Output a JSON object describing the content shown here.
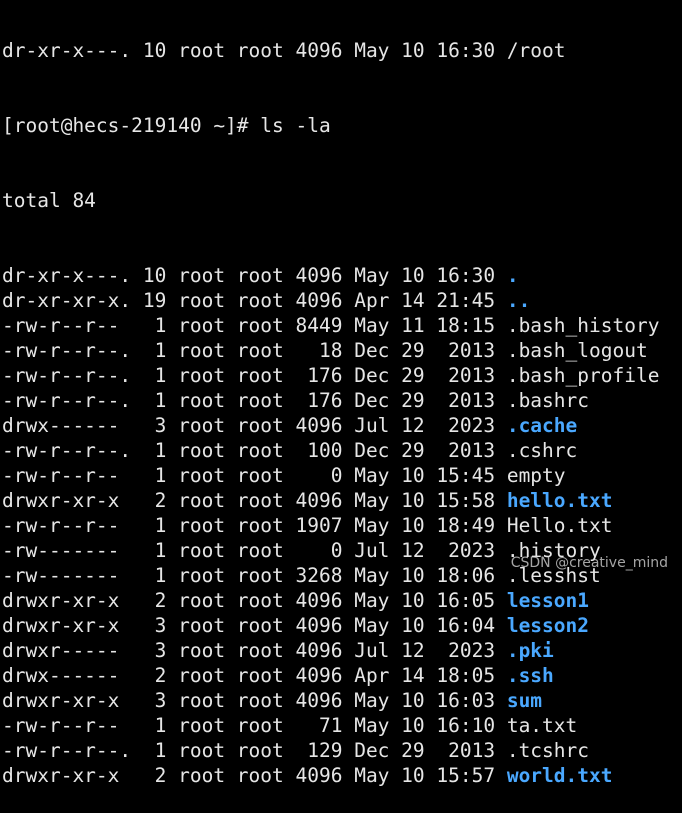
{
  "colors": {
    "background": "#000000",
    "text": "#e6e6e6",
    "directory": "#4aa8ff"
  },
  "terminal": {
    "partial_top_line": "dr-xr-x---. 10 root root 4096 May 10 16:30 /root",
    "prompt_line": "[root@hecs-219140 ~]# ls -la",
    "total_line": "total 84",
    "entries": [
      {
        "meta": "dr-xr-x---. 10 root root 4096 May 10 16:30 ",
        "name": ".",
        "dir": true
      },
      {
        "meta": "dr-xr-xr-x. 19 root root 4096 Apr 14 21:45 ",
        "name": "..",
        "dir": true
      },
      {
        "meta": "-rw-r--r--   1 root root 8449 May 11 18:15 ",
        "name": ".bash_history",
        "dir": false
      },
      {
        "meta": "-rw-r--r--.  1 root root   18 Dec 29  2013 ",
        "name": ".bash_logout",
        "dir": false
      },
      {
        "meta": "-rw-r--r--.  1 root root  176 Dec 29  2013 ",
        "name": ".bash_profile",
        "dir": false
      },
      {
        "meta": "-rw-r--r--.  1 root root  176 Dec 29  2013 ",
        "name": ".bashrc",
        "dir": false
      },
      {
        "meta": "drwx------   3 root root 4096 Jul 12  2023 ",
        "name": ".cache",
        "dir": true
      },
      {
        "meta": "-rw-r--r--.  1 root root  100 Dec 29  2013 ",
        "name": ".cshrc",
        "dir": false
      },
      {
        "meta": "-rw-r--r--   1 root root    0 May 10 15:45 ",
        "name": "empty",
        "dir": false
      },
      {
        "meta": "drwxr-xr-x   2 root root 4096 May 10 15:58 ",
        "name": "hello.txt",
        "dir": true
      },
      {
        "meta": "-rw-r--r--   1 root root 1907 May 10 18:49 ",
        "name": "Hello.txt",
        "dir": false
      },
      {
        "meta": "-rw-------   1 root root    0 Jul 12  2023 ",
        "name": ".history",
        "dir": false
      },
      {
        "meta": "-rw-------   1 root root 3268 May 10 18:06 ",
        "name": ".lesshst",
        "dir": false
      },
      {
        "meta": "drwxr-xr-x   2 root root 4096 May 10 16:05 ",
        "name": "lesson1",
        "dir": true
      },
      {
        "meta": "drwxr-xr-x   3 root root 4096 May 10 16:04 ",
        "name": "lesson2",
        "dir": true
      },
      {
        "meta": "drwxr-----   3 root root 4096 Jul 12  2023 ",
        "name": ".pki",
        "dir": true
      },
      {
        "meta": "drwx------   2 root root 4096 Apr 14 18:05 ",
        "name": ".ssh",
        "dir": true
      },
      {
        "meta": "drwxr-xr-x   3 root root 4096 May 10 16:03 ",
        "name": "sum",
        "dir": true
      },
      {
        "meta": "-rw-r--r--   1 root root   71 May 10 16:10 ",
        "name": "ta.txt",
        "dir": false
      },
      {
        "meta": "-rw-r--r--.  1 root root  129 Dec 29  2013 ",
        "name": ".tcshrc",
        "dir": false
      },
      {
        "meta": "drwxr-xr-x   2 root root 4096 May 10 15:57 ",
        "name": "world.txt",
        "dir": true
      }
    ]
  },
  "watermark": "CSDN @creative_mind"
}
